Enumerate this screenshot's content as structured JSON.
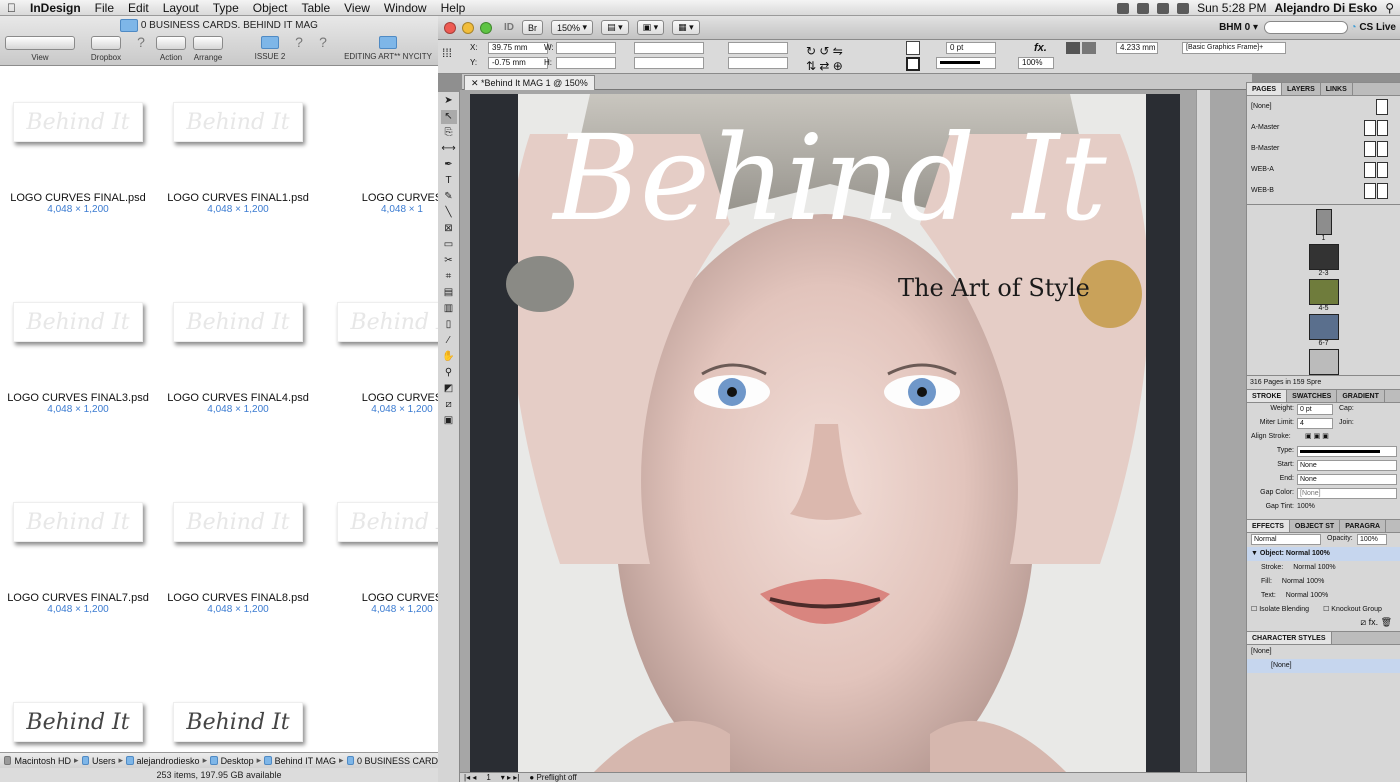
{
  "menubar": {
    "app": "InDesign",
    "items": [
      "File",
      "Edit",
      "Layout",
      "Type",
      "Object",
      "Table",
      "View",
      "Window",
      "Help"
    ],
    "clock": "Sun 5:28 PM",
    "user": "Alejandro Di Esko"
  },
  "finder": {
    "title": "0 BUSINESS CARDS. BEHIND IT MAG",
    "toolbar": [
      "View",
      "Dropbox",
      "Action",
      "Arrange",
      "ISSUE 2",
      "EDITING ART** NYCITY"
    ],
    "files": [
      {
        "name": "",
        "dim": "",
        "thumb": "Behind It"
      },
      {
        "name": "",
        "dim": "",
        "thumb": "Behind It"
      },
      {
        "name": "LOGO CURVES",
        "dim": "4,048 × 1",
        "thumb": ""
      },
      {
        "name": "LOGO CURVES FINAL.psd",
        "dim": "4,048 × 1,200",
        "thumb": ""
      },
      {
        "name": "LOGO CURVES FINAL1.psd",
        "dim": "4,048 × 1,200",
        "thumb": ""
      },
      {
        "name": "",
        "dim": "",
        "thumb": "Behind It"
      },
      {
        "name": "",
        "dim": "",
        "thumb": "Behind It"
      },
      {
        "name": "",
        "dim": "",
        "thumb": "Behind It"
      },
      {
        "name": "LOGO CURVES FINAL3.psd",
        "dim": "4,048 × 1,200",
        "thumb": ""
      },
      {
        "name": "LOGO CURVES FINAL4.psd",
        "dim": "4,048 × 1,200",
        "thumb": ""
      },
      {
        "name": "LOGO CURVES",
        "dim": "4,048 × 1,200",
        "thumb": ""
      },
      {
        "name": "",
        "dim": "",
        "thumb": "Behind It"
      },
      {
        "name": "",
        "dim": "",
        "thumb": "Behind It"
      },
      {
        "name": "",
        "dim": "",
        "thumb": "Behind It"
      },
      {
        "name": "LOGO CURVES FINAL7.psd",
        "dim": "4,048 × 1,200",
        "thumb": ""
      },
      {
        "name": "LOGO CURVES FINAL8.psd",
        "dim": "4,048 × 1,200",
        "thumb": ""
      },
      {
        "name": "LOGO CURVES",
        "dim": "4,048 × 1,200",
        "thumb": ""
      },
      {
        "name": "",
        "dim": "",
        "thumb": "Behind It"
      },
      {
        "name": "",
        "dim": "",
        "thumb": "Behind It"
      }
    ],
    "path": [
      "Macintosh HD",
      "Users",
      "alejandrodiesko",
      "Desktop",
      "Behind IT MAG",
      "0 BUSINESS CARD"
    ],
    "status": "253 items, 197.95 GB available"
  },
  "indesign": {
    "zoom": "150%",
    "workspace": "BHM 0",
    "cslive": "CS Live",
    "control": {
      "x": "39.75 mm",
      "y": "-0.75 mm",
      "stroke_weight": "0 pt",
      "opacity": "100%",
      "width_val": "4.233 mm",
      "object_style": "[Basic Graphics Frame]+"
    },
    "doc_tab": "*Behind It MAG 1 @ 150%",
    "cover": {
      "masthead": "Behind It",
      "tagline": "The Art of Style"
    },
    "bottom": {
      "page": "1",
      "preflight": "Preflight off"
    },
    "pages_panel": {
      "tabs": [
        "PAGES",
        "LAYERS",
        "LINKS"
      ],
      "masters": [
        "[None]",
        "A-Master",
        "B-Master",
        "WEB-A",
        "WEB-B"
      ],
      "spreads": [
        "1",
        "2-3",
        "4-5",
        "6-7"
      ],
      "footer": "316 Pages in 159 Spre"
    },
    "stroke_panel": {
      "tabs": [
        "STROKE",
        "SWATCHES",
        "GRADIENT"
      ],
      "weight_label": "Weight:",
      "weight": "0 pt",
      "cap_label": "Cap:",
      "miter_label": "Miter Limit:",
      "miter": "4",
      "join_label": "Join:",
      "align_label": "Align Stroke:",
      "type_label": "Type:",
      "start_label": "Start:",
      "start": "None",
      "end_label": "End:",
      "end": "None",
      "gapcolor_label": "Gap Color:",
      "gapcolor": "[None]",
      "gaptint_label": "Gap Tint:",
      "gaptint": "100%"
    },
    "effects_panel": {
      "tabs": [
        "EFFECTS",
        "OBJECT ST",
        "PARAGRA"
      ],
      "mode": "Normal",
      "opacity_label": "Opacity:",
      "opacity": "100%",
      "object": "Object: Normal 100%",
      "rows": [
        {
          "k": "Stroke:",
          "v": "Normal 100%"
        },
        {
          "k": "Fill:",
          "v": "Normal 100%"
        },
        {
          "k": "Text:",
          "v": "Normal 100%"
        }
      ],
      "isolate": "Isolate Blending",
      "knockout": "Knockout Group"
    },
    "char_panel": {
      "title": "CHARACTER STYLES",
      "items": [
        "[None]",
        "[None]"
      ]
    }
  },
  "colors": {
    "accent": "#3b7bd1",
    "panel": "#d7d7d7"
  }
}
